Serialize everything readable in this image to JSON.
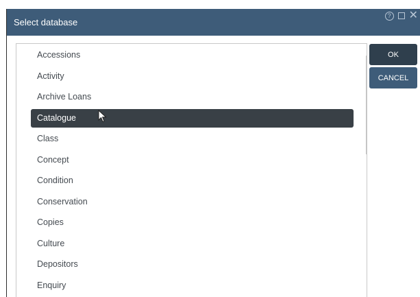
{
  "window": {
    "title": "Select database",
    "controls": [
      "help-icon",
      "maximize-icon",
      "close-icon"
    ]
  },
  "list": {
    "items": [
      {
        "label": "Accessions",
        "selected": false
      },
      {
        "label": "Activity",
        "selected": false
      },
      {
        "label": "Archive Loans",
        "selected": false
      },
      {
        "label": "Catalogue",
        "selected": true
      },
      {
        "label": "Class",
        "selected": false
      },
      {
        "label": "Concept",
        "selected": false
      },
      {
        "label": "Condition",
        "selected": false
      },
      {
        "label": "Conservation",
        "selected": false
      },
      {
        "label": "Copies",
        "selected": false
      },
      {
        "label": "Culture",
        "selected": false
      },
      {
        "label": "Depositors",
        "selected": false
      },
      {
        "label": "Enquiry",
        "selected": false
      }
    ]
  },
  "buttons": {
    "ok_label": "OK",
    "cancel_label": "CANCEL"
  },
  "colors": {
    "titlebar": "#3e5c79",
    "selected_row": "#394046",
    "ok_button": "#2f3f4d",
    "cancel_button": "#3e5c79"
  }
}
